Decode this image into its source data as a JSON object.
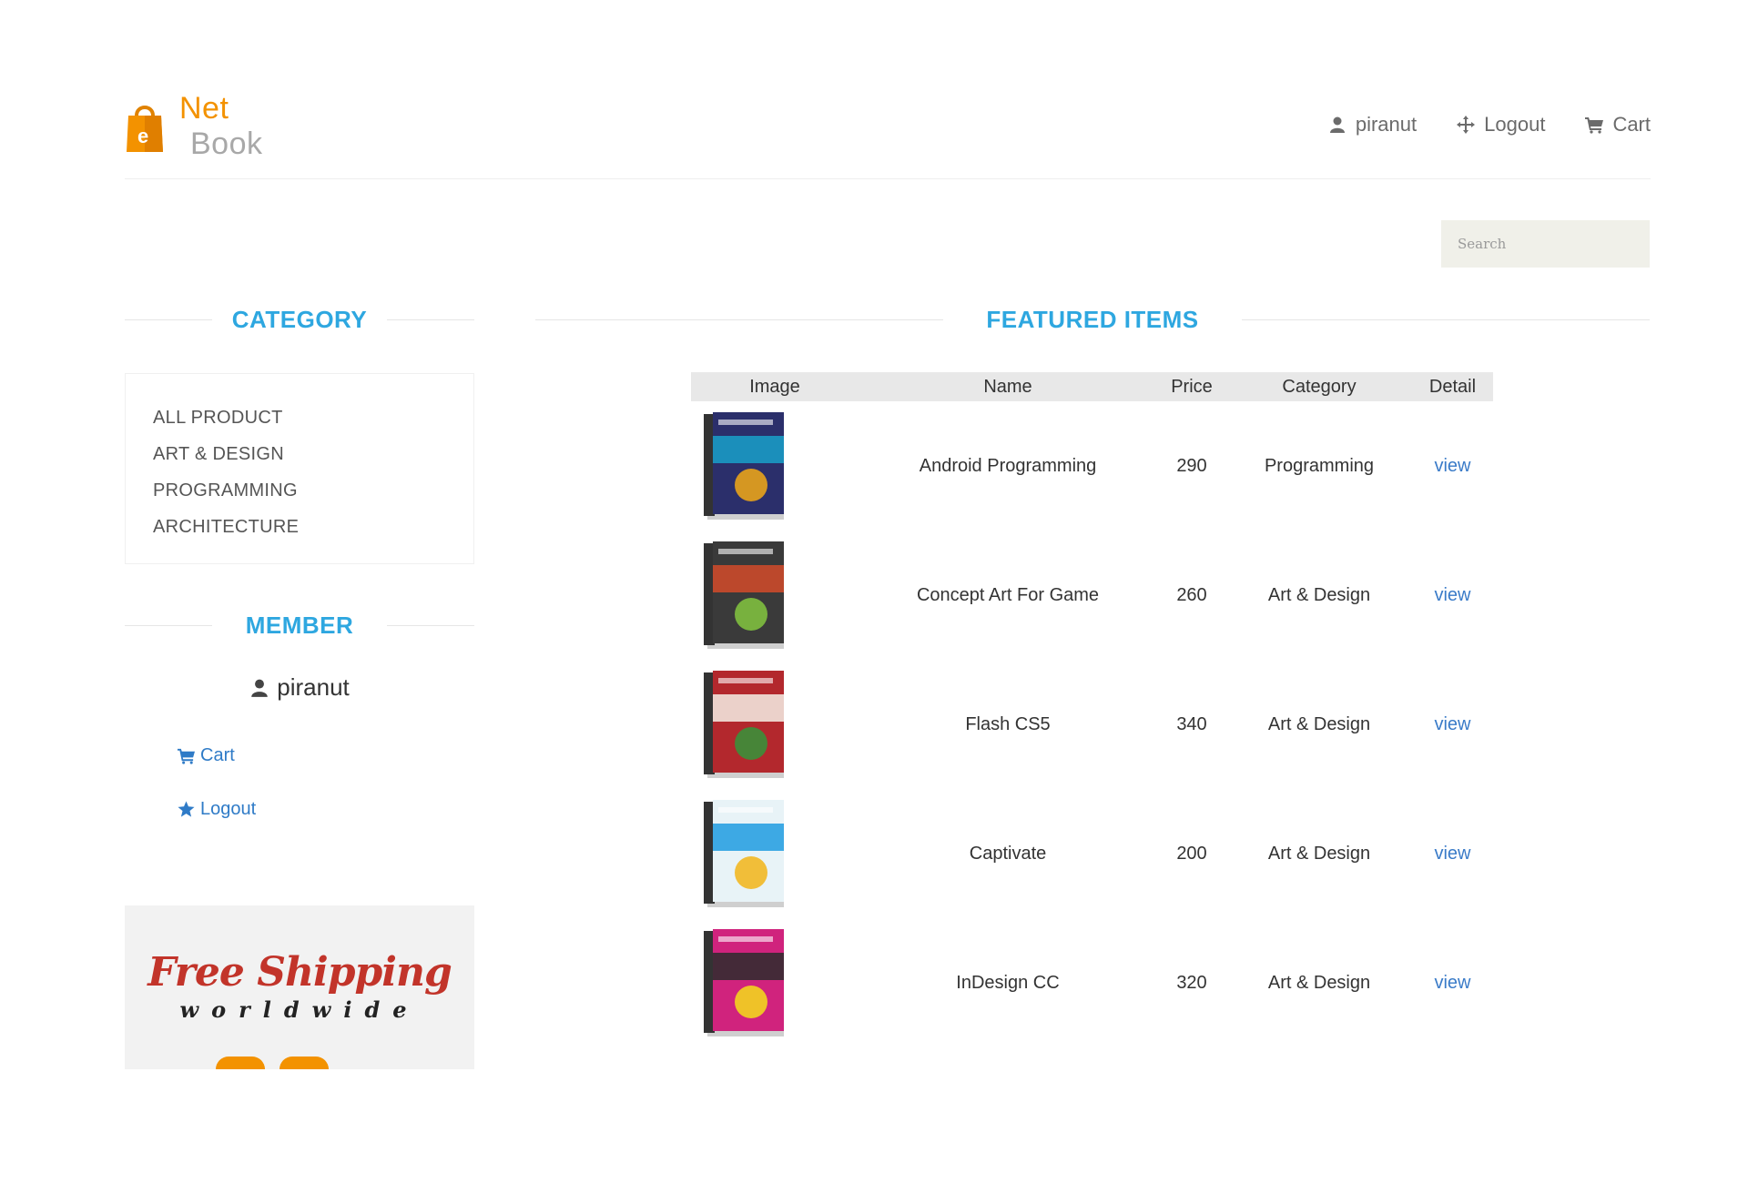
{
  "header": {
    "logo_net": "Net",
    "logo_book": "Book",
    "logo_bag_letter": "e",
    "nav": [
      {
        "label": "piranut",
        "icon": "user-icon"
      },
      {
        "label": "Logout",
        "icon": "crosshair-icon"
      },
      {
        "label": "Cart",
        "icon": "cart-icon"
      }
    ]
  },
  "search": {
    "placeholder": "Search"
  },
  "sidebar": {
    "category_title": "CATEGORY",
    "categories": [
      "ALL PRODUCT",
      "ART & DESIGN",
      "PROGRAMMING",
      "ARCHITECTURE"
    ],
    "member_title": "MEMBER",
    "member_name": "piranut",
    "cart_label": "Cart",
    "logout_label": "Logout"
  },
  "ad": {
    "headline": "Free Shipping",
    "subline": "worldwide"
  },
  "featured": {
    "title": "FEATURED ITEMS",
    "columns": [
      "Image",
      "Name",
      "Price",
      "Category",
      "Detail"
    ],
    "rows": [
      {
        "name": "Android Programming",
        "price": "290",
        "category": "Programming",
        "detail": "view",
        "cover": [
          "#2b2f6b",
          "#19a0c9",
          "#e8a31b"
        ]
      },
      {
        "name": "Concept Art For Game",
        "price": "260",
        "category": "Art & Design",
        "detail": "view",
        "cover": [
          "#3a3a3a",
          "#d44b2a",
          "#7fbf3f"
        ]
      },
      {
        "name": "Flash CS5",
        "price": "340",
        "category": "Art & Design",
        "detail": "view",
        "cover": [
          "#b3282d",
          "#f4efe6",
          "#3b8f3a"
        ]
      },
      {
        "name": "Captivate",
        "price": "200",
        "category": "Art & Design",
        "detail": "view",
        "cover": [
          "#e8f3f7",
          "#1f9be0",
          "#f2b824"
        ]
      },
      {
        "name": "InDesign CC",
        "price": "320",
        "category": "Art & Design",
        "detail": "view",
        "cover": [
          "#d0237d",
          "#2b2b2b",
          "#f2d41f"
        ]
      }
    ]
  },
  "colors": {
    "accent": "#2ea7e0",
    "brand_orange": "#f39200",
    "link": "#3a7bc8"
  }
}
